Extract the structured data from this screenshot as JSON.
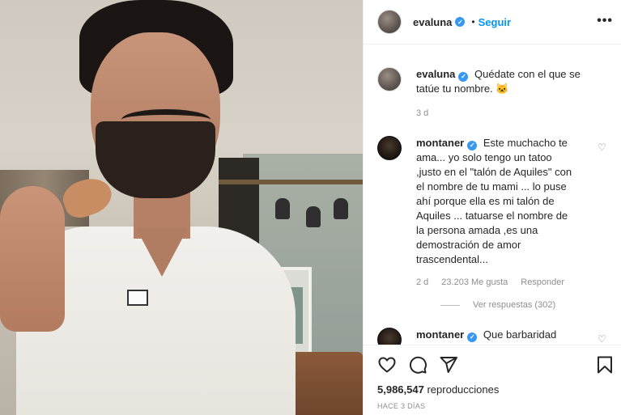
{
  "header": {
    "username": "evaluna",
    "separator": "•",
    "follow_label": "Seguir",
    "more_label": "•••"
  },
  "caption": {
    "username": "evaluna",
    "text": "Quédate con el que se tatúe tu nombre. 🐱",
    "time": "3 d"
  },
  "comments": [
    {
      "username": "montaner",
      "text": "Este muchacho te ama... yo solo tengo un tatoo ,justo en el \"talón de Aquiles\" con el nombre de tu mami ... lo puse ahí porque ella es mi talón de Aquiles ... tatuarse el nombre de la persona amada ,es una demostración de amor trascendental...",
      "time": "2 d",
      "likes": "23.203 Me gusta",
      "reply_label": "Responder",
      "view_replies": "Ver respuestas (302)"
    },
    {
      "username": "montaner",
      "text": "Que barbaridad"
    }
  ],
  "stats": {
    "views_count": "5,986,547",
    "views_label": "reproducciones",
    "posted": "HACE 3 DÍAS"
  },
  "icons": {
    "verified": "verified-badge-icon",
    "like": "heart-icon",
    "comment": "comment-icon",
    "share": "paper-plane-icon",
    "save": "bookmark-icon"
  },
  "colors": {
    "accent": "#0095f6",
    "verified": "#3897f0",
    "muted": "#8e8e8e"
  }
}
